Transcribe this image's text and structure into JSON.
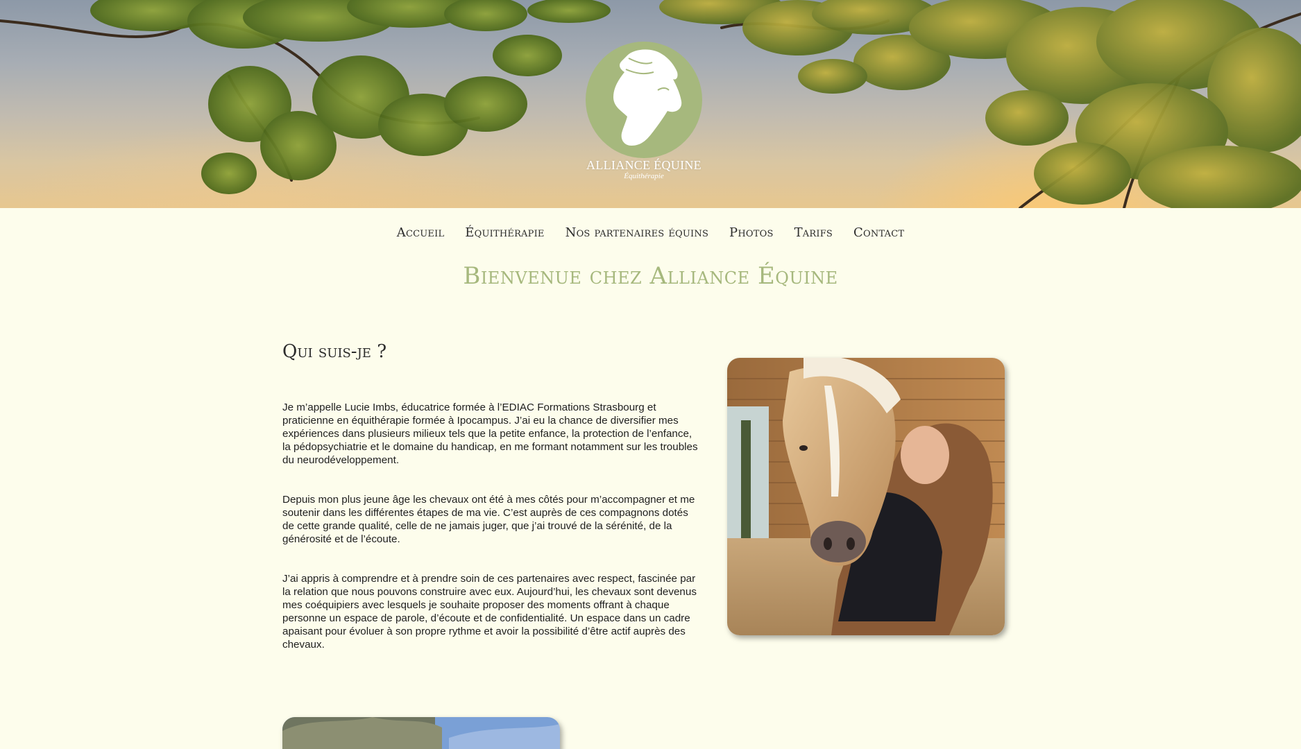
{
  "brand": {
    "name": "ALLIANCE ÉQUINE",
    "tagline": "Équithérapie"
  },
  "nav": {
    "items": [
      {
        "label": "Accueil"
      },
      {
        "label": "Équithérapie"
      },
      {
        "label": "Nos partenaires équins"
      },
      {
        "label": "Photos"
      },
      {
        "label": "Tarifs"
      },
      {
        "label": "Contact"
      }
    ]
  },
  "page": {
    "welcome": "Bienvenue chez Alliance Équine",
    "section_title": "Qui suis-je ?",
    "paragraphs": [
      "Je m’appelle Lucie Imbs, éducatrice formée à l’EDIAC Formations Strasbourg et praticienne en équithérapie formée à Ipocampus. J’ai eu la chance de diversifier mes expériences dans plusieurs milieux tels que la petite enfance, la protection de l’enfance, la pédopsychiatrie et le domaine du handicap, en me formant notamment sur les troubles du neurodéveloppement.",
      "Depuis mon plus jeune âge les chevaux ont été à mes côtés pour m’accompagner et me soutenir dans les différentes étapes de ma vie. C’est auprès de ces compagnons dotés de cette grande qualité, celle de ne jamais juger, que j’ai trouvé de la sérénité, de la générosité et de l’écoute.",
      "J’ai appris à comprendre et à prendre soin de ces partenaires avec respect, fascinée par la relation que nous pouvons construire avec eux. Aujourd’hui, les chevaux sont devenus mes coéquipiers avec lesquels je souhaite proposer des moments offrant à chaque personne un espace de parole, d’écoute et de confidentialité. Un espace dans un cadre apaisant pour évoluer à son propre rythme et avoir la possibilité d’être actif auprès des chevaux."
    ]
  },
  "colors": {
    "background": "#fdfdec",
    "accent_green": "#a6b87d",
    "text": "#1f1f1f"
  }
}
